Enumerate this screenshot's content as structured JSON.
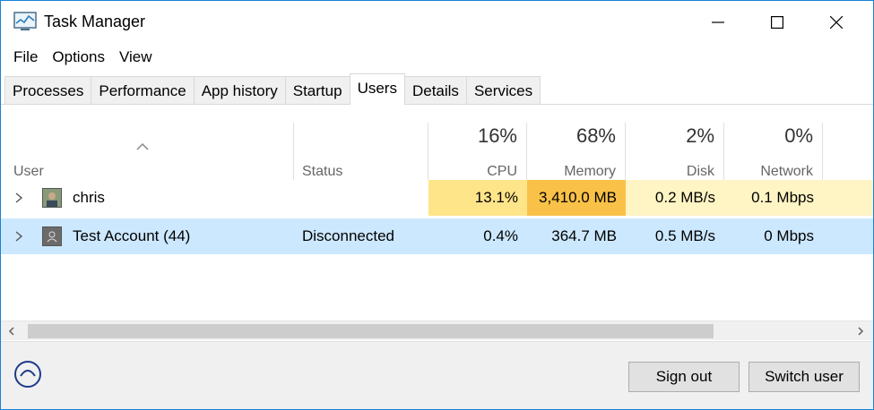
{
  "window": {
    "title": "Task Manager"
  },
  "menu": [
    "File",
    "Options",
    "View"
  ],
  "tabs": [
    {
      "label": "Processes",
      "active": false
    },
    {
      "label": "Performance",
      "active": false
    },
    {
      "label": "App history",
      "active": false
    },
    {
      "label": "Startup",
      "active": false
    },
    {
      "label": "Users",
      "active": true
    },
    {
      "label": "Details",
      "active": false
    },
    {
      "label": "Services",
      "active": false
    }
  ],
  "columns": {
    "user": "User",
    "status": "Status",
    "cpu": {
      "pct": "16%",
      "label": "CPU"
    },
    "memory": {
      "pct": "68%",
      "label": "Memory"
    },
    "disk": {
      "pct": "2%",
      "label": "Disk"
    },
    "network": {
      "pct": "0%",
      "label": "Network"
    }
  },
  "rows": [
    {
      "user": "chris",
      "status": "",
      "cpu": "13.1%",
      "memory": "3,410.0 MB",
      "disk": "0.2 MB/s",
      "network": "0.1 Mbps",
      "selected": false
    },
    {
      "user": "Test Account (44)",
      "status": "Disconnected",
      "cpu": "0.4%",
      "memory": "364.7 MB",
      "disk": "0.5 MB/s",
      "network": "0 Mbps",
      "selected": true
    }
  ],
  "buttons": {
    "sign_out": "Sign out",
    "switch_user": "Switch user"
  },
  "colors": {
    "selected_row": "#cce8ff",
    "heat_low": "#fff4c4",
    "heat_mid": "#ffe58a",
    "heat_high": "#f9c147",
    "accent": "#1883d7"
  }
}
